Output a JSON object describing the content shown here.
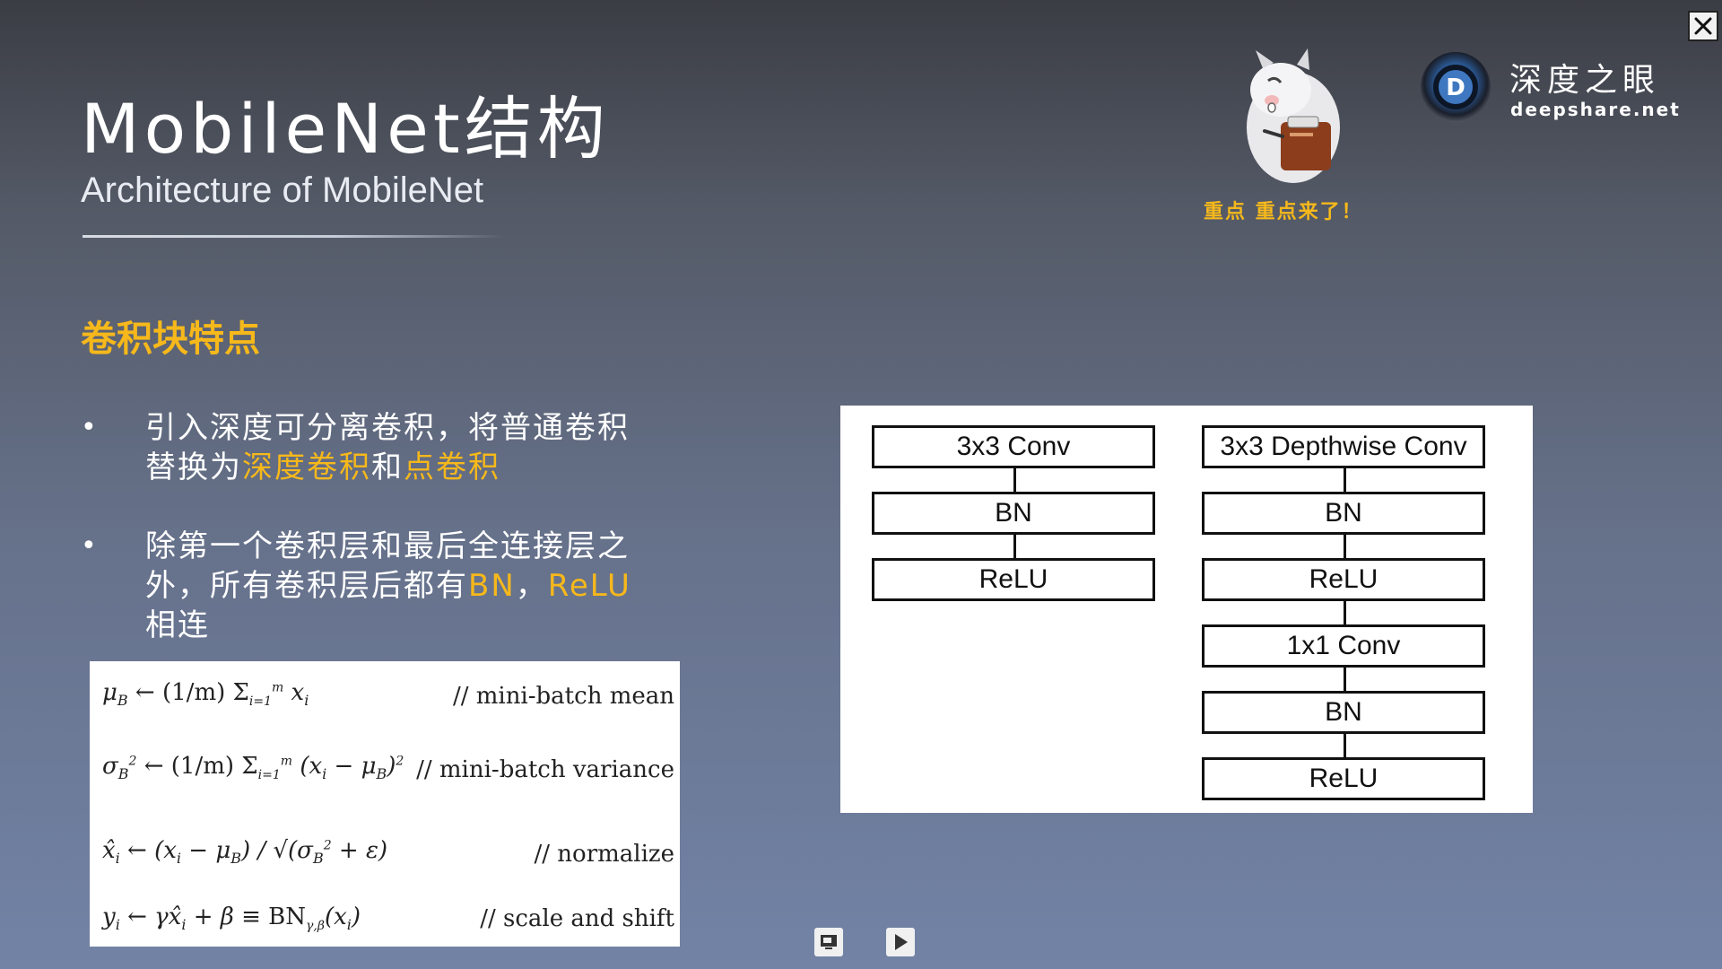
{
  "slide": {
    "title": "MobileNet结构",
    "subtitle": "Architecture of MobileNet",
    "section_heading": "卷积块特点"
  },
  "bullets": [
    {
      "parts": [
        {
          "text": "引入深度可分离卷积，将普通卷积替换为",
          "highlight": false
        },
        {
          "text": "深度卷积",
          "highlight": true
        },
        {
          "text": "和",
          "highlight": false
        },
        {
          "text": "点卷积",
          "highlight": true
        }
      ]
    },
    {
      "parts": [
        {
          "text": "除第一个卷积层和最后全连接层之外，所有卷积层后都有",
          "highlight": false
        },
        {
          "text": "BN",
          "highlight": true
        },
        {
          "text": "，",
          "highlight": false
        },
        {
          "text": "ReLU",
          "highlight": true
        },
        {
          "text": "相连",
          "highlight": false
        }
      ]
    }
  ],
  "formulas": [
    {
      "comment": "// mini-batch mean"
    },
    {
      "comment": "// mini-batch variance"
    },
    {
      "comment": "// normalize"
    },
    {
      "comment": "// scale and shift"
    }
  ],
  "diagram": {
    "left_column": [
      "3x3 Conv",
      "BN",
      "ReLU"
    ],
    "right_column": [
      "3x3 Depthwise Conv",
      "BN",
      "ReLU",
      "1x1 Conv",
      "BN",
      "ReLU"
    ]
  },
  "mascot": {
    "caption": "重点  重点来了！"
  },
  "logo": {
    "name_cn": "深度之眼",
    "site": "deepshare.net",
    "letter": "D"
  },
  "colors": {
    "highlight": "#f6b81b",
    "background_top": "#3b3d44",
    "background_bottom": "#7283a6",
    "diagram_stroke": "#111111"
  },
  "icons": {
    "close": "close-icon",
    "screen": "screen-icon",
    "play": "play-icon"
  }
}
